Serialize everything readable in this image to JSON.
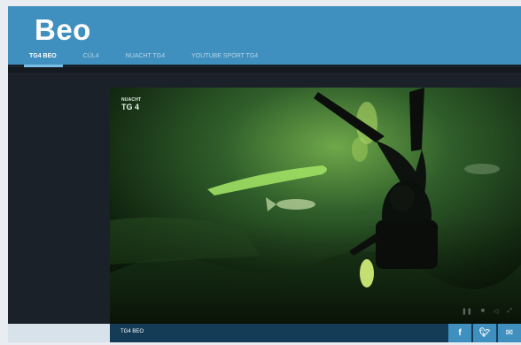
{
  "header": {
    "logo": "Beo",
    "tabs": [
      {
        "label": "TG4 BEO",
        "active": true
      },
      {
        "label": "CÚL4",
        "active": false
      },
      {
        "label": "NUACHT TG4",
        "active": false
      },
      {
        "label": "YOUTUBE SPÓRT TG4",
        "active": false
      }
    ]
  },
  "player": {
    "watermark_top": "NUACHT",
    "watermark_main": "TG 4",
    "scene": "underwater diver with fish"
  },
  "bottom": {
    "caption": "TG4 BEO",
    "share_icons": [
      "facebook-icon",
      "twitter-icon",
      "email-icon"
    ]
  },
  "colors": {
    "brand": "#3f8fbf",
    "page_dark": "#1b2128",
    "caption_bar": "#153c56"
  }
}
